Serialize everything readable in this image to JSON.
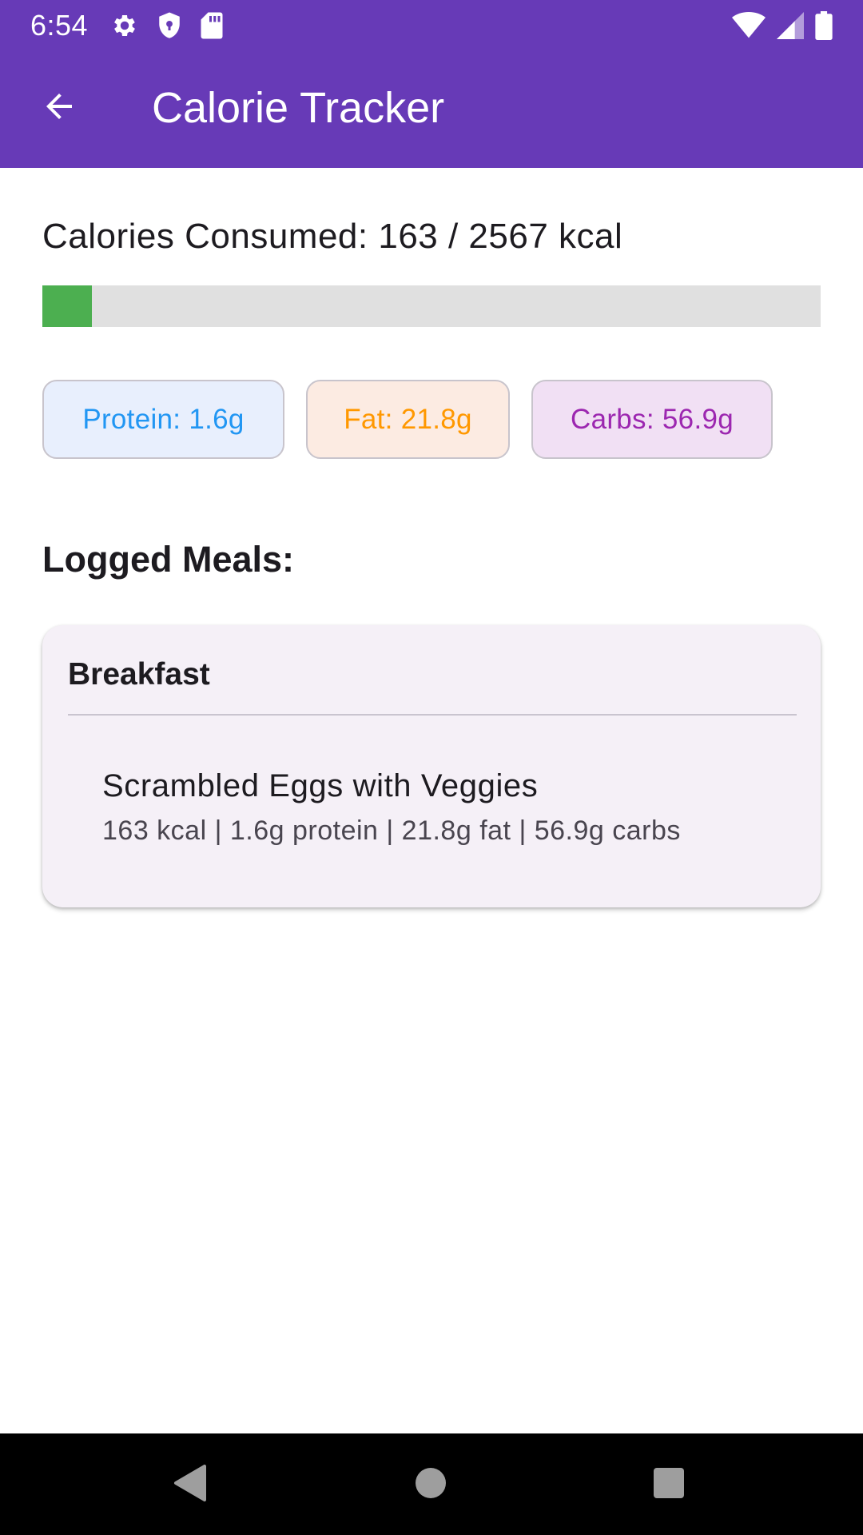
{
  "status_bar": {
    "time": "6:54",
    "left_icons": [
      "settings-gear-icon",
      "shield-icon",
      "sd-card-icon"
    ],
    "right_icons": [
      "wifi-icon",
      "signal-icon",
      "battery-icon"
    ]
  },
  "app_bar": {
    "title": "Calorie Tracker",
    "back_icon": "arrow-back-icon",
    "background_color": "#673ab7"
  },
  "summary": {
    "calories_text": "Calories Consumed: 163 / 2567 kcal",
    "calories_consumed": 163,
    "calories_goal": 2567,
    "progress_fraction": 0.0635,
    "progress_color": "#4caf50"
  },
  "macros": {
    "protein_label": "Protein: 1.6g",
    "fat_label": "Fat: 21.8g",
    "carbs_label": "Carbs: 56.9g",
    "protein_color": "#2196f3",
    "fat_color": "#ff9800",
    "carbs_color": "#9c27b0"
  },
  "logged_meals": {
    "heading": "Logged Meals:",
    "meals": [
      {
        "name": "Breakfast",
        "items": [
          {
            "name": "Scrambled Eggs with Veggies",
            "details": "163 kcal | 1.6g protein | 21.8g fat | 56.9g carbs"
          }
        ]
      }
    ]
  },
  "nav_bar": {
    "buttons": [
      "nav-back-icon",
      "nav-home-icon",
      "nav-recents-icon"
    ]
  }
}
